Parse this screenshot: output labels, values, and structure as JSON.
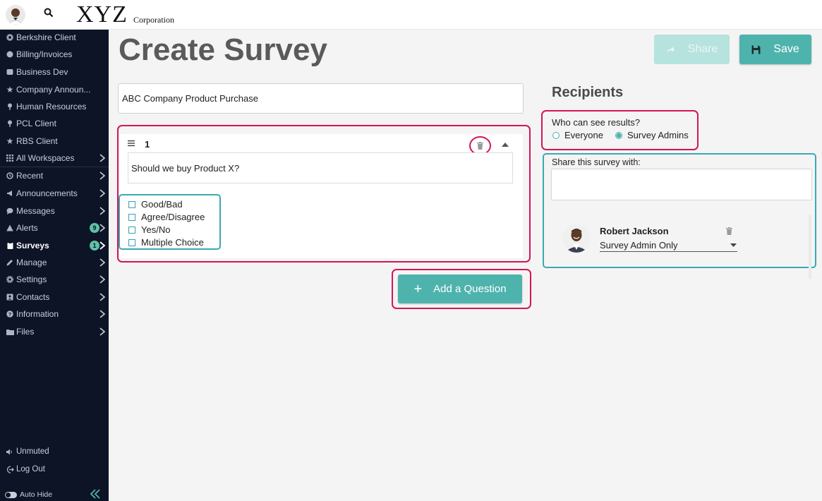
{
  "header": {
    "logo_main": "XYZ",
    "logo_sub": "Corporation"
  },
  "sidebar": {
    "items": [
      {
        "label": "Berkshire Client",
        "icon": "gear-icon"
      },
      {
        "label": "Billing/Invoices",
        "icon": "coins-icon"
      },
      {
        "label": "Business Dev",
        "icon": "briefcase-icon"
      },
      {
        "label": "Company Announ...",
        "icon": "star-icon"
      },
      {
        "label": "Human Resources",
        "icon": "pin-icon"
      },
      {
        "label": "PCL Client",
        "icon": "pin-icon"
      },
      {
        "label": "RBS Client",
        "icon": "star-icon"
      },
      {
        "label": "All Workspaces",
        "icon": "grid-icon"
      },
      {
        "label": "Recent",
        "icon": "history-icon"
      },
      {
        "label": "Announcements",
        "icon": "megaphone-icon"
      },
      {
        "label": "Messages",
        "icon": "chat-icon"
      },
      {
        "label": "Alerts",
        "icon": "warning-icon",
        "badge": "9"
      },
      {
        "label": "Surveys",
        "icon": "clipboard-icon",
        "badge": "1"
      },
      {
        "label": "Manage",
        "icon": "pencil-icon"
      },
      {
        "label": "Settings",
        "icon": "cog-icon"
      },
      {
        "label": "Contacts",
        "icon": "contact-card-icon"
      },
      {
        "label": "Information",
        "icon": "question-icon"
      },
      {
        "label": "Files",
        "icon": "folder-icon"
      }
    ],
    "unmuted_label": "Unmuted",
    "logout_label": "Log Out",
    "autohide_label": "Auto Hide"
  },
  "main": {
    "title": "Create Survey",
    "share_label": "Share",
    "save_label": "Save",
    "survey_title_value": "ABC Company Product Purchase",
    "question": {
      "number": "1",
      "text": "Should we buy Product X?",
      "options": [
        "Good/Bad",
        "Agree/Disagree",
        "Yes/No",
        "Multiple Choice"
      ]
    },
    "add_question_label": "Add a Question"
  },
  "recipients": {
    "title": "Recipients",
    "visibility_label": "Who can see results?",
    "visibility_options": [
      "Everyone",
      "Survey Admins"
    ],
    "visibility_selected": "Survey Admins",
    "share_with_label": "Share this survey with:",
    "share_with_placeholder": "",
    "user": {
      "name": "Robert Jackson",
      "role": "Survey Admin Only"
    }
  },
  "colors": {
    "sidebar_bg": "#0d1426",
    "accent_teal": "#4fb3ad",
    "highlight_pink": "#d4145a",
    "highlight_teal": "#3aa9b3",
    "badge_green": "#5fc2a6"
  }
}
